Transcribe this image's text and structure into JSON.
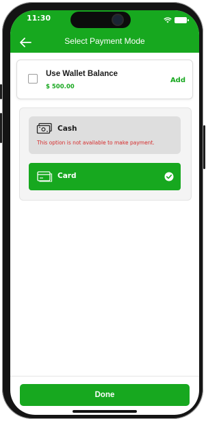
{
  "status_bar": {
    "time": "11:30"
  },
  "header": {
    "title": "Select Payment Mode",
    "back_icon": "arrow-left-icon"
  },
  "wallet": {
    "label": "Use Wallet Balance",
    "amount": "$ 500.00",
    "checked": false,
    "add_label": "Add"
  },
  "payment_options": {
    "cash": {
      "label": "Cash",
      "warning": "This option is not available to make payment.",
      "enabled": false,
      "icon": "cash-icon"
    },
    "card": {
      "label": "Card",
      "selected": true,
      "icon": "card-icon"
    }
  },
  "footer": {
    "done_label": "Done"
  },
  "colors": {
    "accent": "#17a81f",
    "warning": "#d62b2b",
    "disabled_bg": "#dedede"
  }
}
